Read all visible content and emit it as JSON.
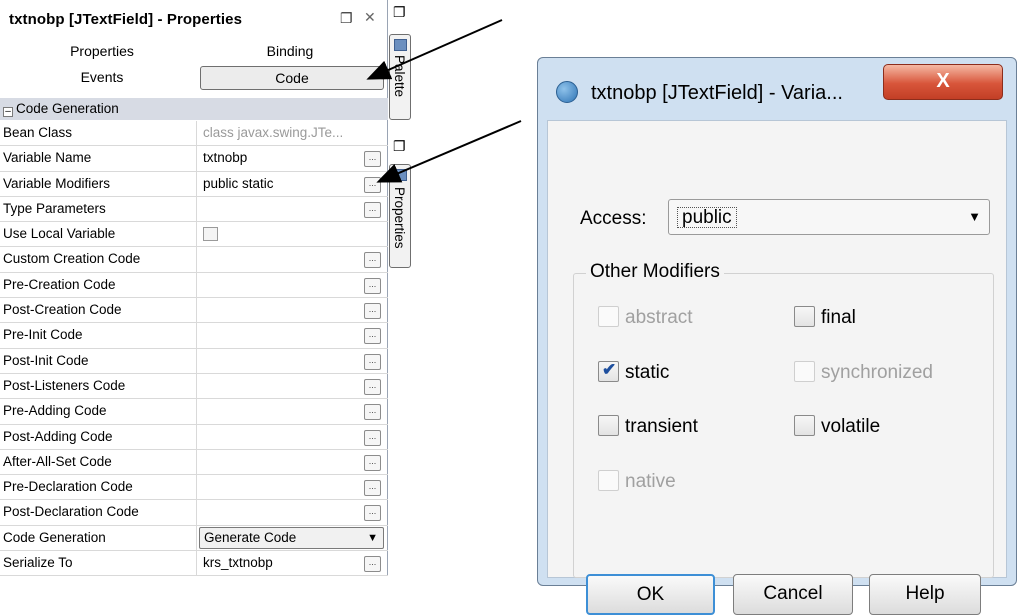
{
  "properties_panel": {
    "title": "txtnobp [JTextField] - Properties",
    "tabs": [
      "Properties",
      "Binding",
      "Events",
      "Code"
    ],
    "section": "Code Generation",
    "rows": [
      {
        "label": "Bean Class",
        "value": "class javax.swing.JTe..."
      },
      {
        "label": "Variable Name",
        "value": "txtnobp"
      },
      {
        "label": "Variable Modifiers",
        "value": "public static"
      },
      {
        "label": "Type Parameters",
        "value": ""
      },
      {
        "label": "Use Local Variable",
        "value": ""
      },
      {
        "label": "Custom Creation Code",
        "value": ""
      },
      {
        "label": "Pre-Creation Code",
        "value": ""
      },
      {
        "label": "Post-Creation Code",
        "value": ""
      },
      {
        "label": "Pre-Init Code",
        "value": ""
      },
      {
        "label": "Post-Init Code",
        "value": ""
      },
      {
        "label": "Post-Listeners Code",
        "value": ""
      },
      {
        "label": "Pre-Adding Code",
        "value": ""
      },
      {
        "label": "Post-Adding Code",
        "value": ""
      },
      {
        "label": "After-All-Set Code",
        "value": ""
      },
      {
        "label": "Pre-Declaration Code",
        "value": ""
      },
      {
        "label": "Post-Declaration Code",
        "value": ""
      },
      {
        "label": "Code Generation",
        "value": "Generate Code"
      },
      {
        "label": "Serialize To",
        "value": "krs_txtnobp"
      }
    ],
    "ellipsis": "...",
    "side_labels": [
      "Palette",
      "Properties"
    ]
  },
  "dialog": {
    "title": "txtnobp [JTextField] - Varia...",
    "close": "X",
    "access_label": "Access:",
    "access_value": "public",
    "group_title": "Other Modifiers",
    "modifiers": {
      "abstract": {
        "label": "abstract",
        "checked": false,
        "enabled": false
      },
      "final": {
        "label": "final",
        "checked": false,
        "enabled": true
      },
      "static": {
        "label": "static",
        "checked": true,
        "enabled": true
      },
      "synchronized": {
        "label": "synchronized",
        "checked": false,
        "enabled": false
      },
      "transient": {
        "label": "transient",
        "checked": false,
        "enabled": true
      },
      "volatile": {
        "label": "volatile",
        "checked": false,
        "enabled": true
      },
      "native": {
        "label": "native",
        "checked": false,
        "enabled": false
      }
    },
    "buttons": {
      "ok": "OK",
      "cancel": "Cancel",
      "help": "Help"
    }
  }
}
